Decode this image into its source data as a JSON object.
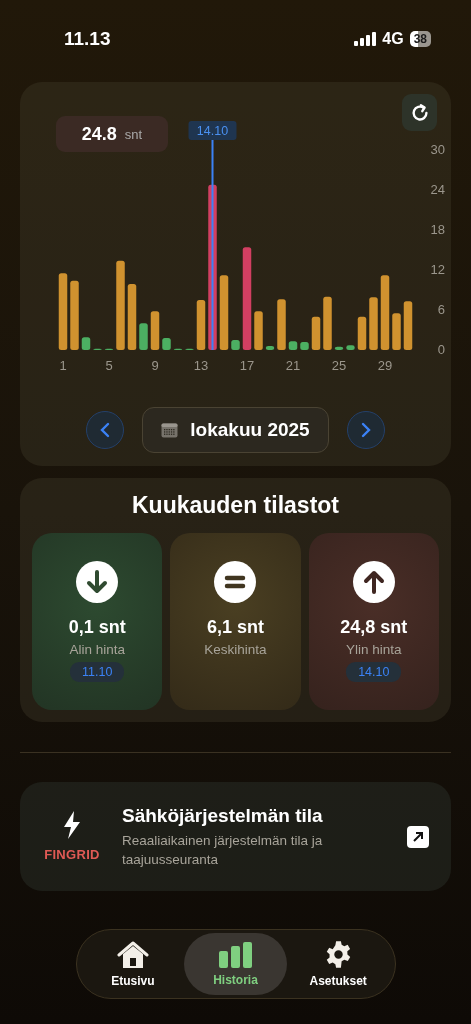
{
  "status_bar": {
    "time": "11.13",
    "network": "4G",
    "battery": "38"
  },
  "price_chart": {
    "readout": {
      "value": "24.8",
      "unit": "snt"
    },
    "chart_data": {
      "type": "bar",
      "x": [
        1,
        2,
        3,
        4,
        5,
        6,
        7,
        8,
        9,
        10,
        11,
        12,
        13,
        14,
        15,
        16,
        17,
        18,
        19,
        20,
        21,
        22,
        23,
        24,
        25,
        26,
        27,
        28,
        29,
        30,
        31
      ],
      "series": [
        {
          "color": "#4caf62",
          "values": [
            null,
            null,
            1.9,
            0.2,
            0.2,
            null,
            null,
            4.0,
            null,
            1.8,
            0.2,
            0.2,
            null,
            null,
            null,
            1.5,
            null,
            null,
            0.6,
            null,
            1.3,
            1.2,
            null,
            null,
            0.5,
            0.7,
            null,
            null,
            null,
            null,
            null
          ]
        },
        {
          "color": "#d0922f",
          "values": [
            11.5,
            10.4,
            null,
            null,
            null,
            13.4,
            9.9,
            null,
            5.8,
            null,
            null,
            null,
            7.5,
            null,
            11.2,
            null,
            null,
            5.8,
            null,
            7.6,
            null,
            null,
            5.0,
            8.0,
            null,
            null,
            5.0,
            7.9,
            11.2,
            5.5,
            7.3
          ]
        },
        {
          "color": "#d23f62",
          "values": [
            null,
            null,
            null,
            null,
            null,
            null,
            null,
            null,
            null,
            null,
            null,
            null,
            null,
            24.8,
            null,
            null,
            15.4,
            null,
            null,
            null,
            null,
            null,
            null,
            null,
            null,
            null,
            null,
            null,
            null,
            null,
            null
          ]
        }
      ],
      "xlim": [
        0.5,
        31.5
      ],
      "ylim": [
        0,
        30
      ],
      "yticks": [
        0,
        6,
        12,
        18,
        24,
        30
      ],
      "xticks": [
        1,
        5,
        9,
        13,
        17,
        21,
        25,
        29
      ],
      "ref_lines": [
        {
          "axis": "x",
          "value": 14
        }
      ],
      "annotations": [
        "14.10"
      ]
    },
    "month": "lokakuu 2025"
  },
  "stats": {
    "title": "Kuukauden tilastot",
    "items": [
      {
        "kind": "min",
        "value": "0,1 snt",
        "label": "Alin hinta",
        "date": "11.10"
      },
      {
        "kind": "avg",
        "value": "6,1 snt",
        "label": "Keskihinta"
      },
      {
        "kind": "max",
        "value": "24,8 snt",
        "label": "Ylin hinta",
        "date": "14.10"
      }
    ]
  },
  "system_card": {
    "brand": "FINGRID",
    "title": "Sähköjärjestelmän tila",
    "subtitle": "Reaaliaikainen järjestelmän tila ja taajuusseuranta"
  },
  "tabs": [
    {
      "kind": "home",
      "label": "Etusivu",
      "selected": false
    },
    {
      "kind": "history",
      "label": "Historia",
      "selected": true
    },
    {
      "kind": "settings",
      "label": "Asetukset",
      "selected": false
    }
  ]
}
